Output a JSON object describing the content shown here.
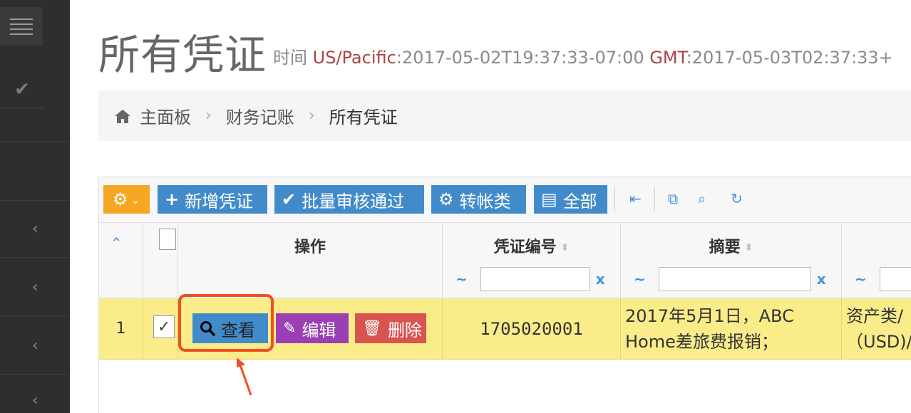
{
  "header": {
    "title": "所有凭证",
    "time_label": "时间",
    "tz1": "US/Pacific",
    "time1": ":2017-05-02T19:37:33-07:00",
    "tz2": "GMT",
    "time2": ":2017-05-03T02:37:33+"
  },
  "breadcrumb": {
    "home": "主面板",
    "section": "财务记账",
    "current": "所有凭证"
  },
  "toolbar": {
    "add_label": "新增凭证",
    "audit_label": "批量审核通过",
    "transfer_label": "转帐类",
    "all_label": "全部"
  },
  "table": {
    "columns": {
      "action": "操作",
      "voucher_no": "凭证编号",
      "summary": "摘要"
    },
    "filter_tilde": "~",
    "filter_clear": "x",
    "rows": [
      {
        "index": "1",
        "view_label": "查看",
        "edit_label": "编辑",
        "delete_label": "删除",
        "voucher_no": "1705020001",
        "summary_line1": "2017年5月1日，ABC",
        "summary_line2": "Home差旅费报销；",
        "account_line1": "资产类/",
        "account_line2": "（USD)/"
      }
    ]
  },
  "colors": {
    "sidebar": "#2e2e2e",
    "primary": "#428bca",
    "warning": "#f5a623",
    "purple": "#9b3fb5",
    "danger": "#d9534f",
    "row_highlight": "#fbec8a",
    "annotation": "#f04e23"
  }
}
